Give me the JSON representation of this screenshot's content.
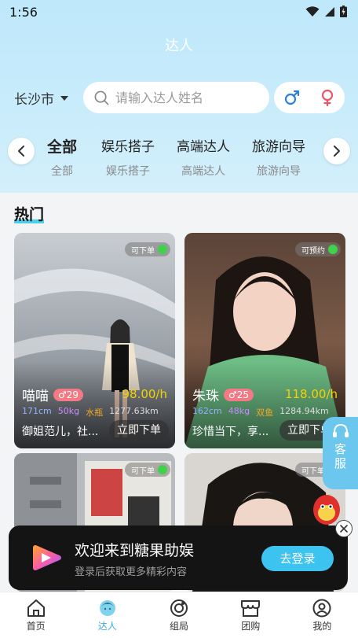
{
  "status_bar": {
    "time": "1:56"
  },
  "header": {
    "title": "达人"
  },
  "search": {
    "city": "长沙市",
    "placeholder": "请输入达人姓名"
  },
  "tabs": [
    {
      "label": "全部",
      "sub": "全部",
      "active": true
    },
    {
      "label": "娱乐搭子",
      "sub": "娱乐搭子",
      "active": false
    },
    {
      "label": "高端达人",
      "sub": "高端达人",
      "active": false
    },
    {
      "label": "旅游向导",
      "sub": "旅游向导",
      "active": false
    }
  ],
  "section": {
    "title": "热门"
  },
  "cards": [
    {
      "availability": "可下单",
      "name": "喵喵",
      "age": "♂29",
      "price": "98.00/h",
      "height": "171cm",
      "weight": "50kg",
      "sign": "水瓶",
      "distance": "1277.63km",
      "desc": "御姐范儿，社...",
      "order": "立即下单"
    },
    {
      "availability": "可预约",
      "name": "朱珠",
      "age": "♂25",
      "price": "118.00/h",
      "height": "162cm",
      "weight": "48kg",
      "sign": "双鱼",
      "distance": "1284.94km",
      "desc": "珍惜当下，享...",
      "order": "立即下单"
    },
    {
      "availability": "可下单"
    },
    {
      "availability": "可下单"
    }
  ],
  "customer_service": {
    "label_line1": "客",
    "label_line2": "服"
  },
  "banner": {
    "headline": "欢迎来到糖果助娱",
    "subline": "登录后获取更多精彩内容",
    "button": "去登录"
  },
  "bottom_nav": [
    {
      "label": "首页",
      "icon": "home-icon",
      "active": false
    },
    {
      "label": "达人",
      "icon": "talent-icon",
      "active": true
    },
    {
      "label": "组局",
      "icon": "group-icon",
      "active": false
    },
    {
      "label": "团购",
      "icon": "shop-icon",
      "active": false
    },
    {
      "label": "我的",
      "icon": "profile-icon",
      "active": false
    }
  ],
  "colors": {
    "accent": "#4ad0ea",
    "price": "#f5d300",
    "available_dot": "#3fd24a",
    "login_button": "#3cc3f0"
  }
}
